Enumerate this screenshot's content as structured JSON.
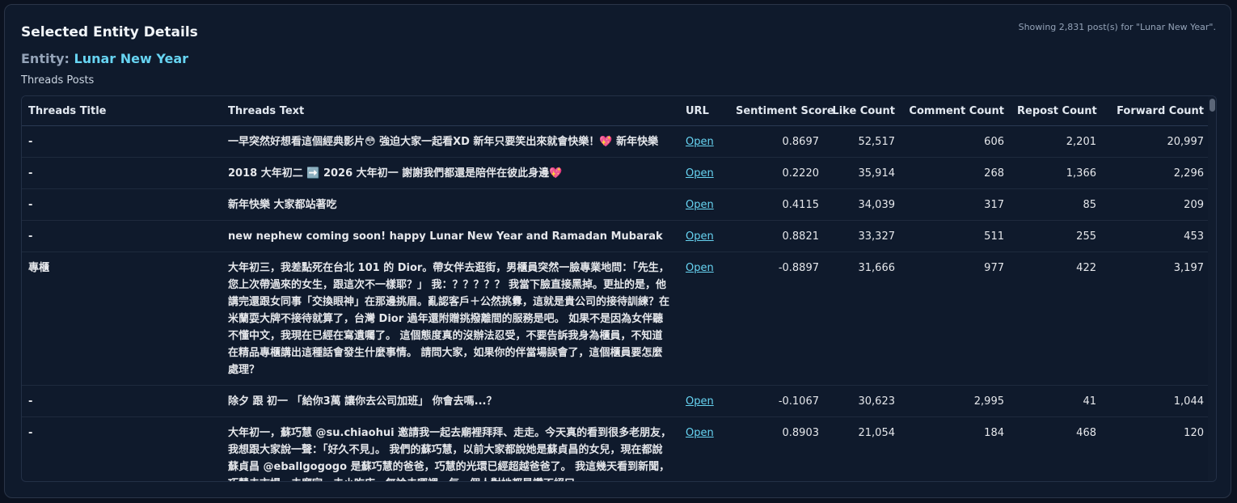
{
  "header": {
    "title": "Selected Entity Details",
    "showing_text": "Showing 2,831 post(s) for \"Lunar New Year\".",
    "entity_prefix": "Entity:",
    "entity_name": "Lunar New Year",
    "section_label": "Threads Posts"
  },
  "table": {
    "columns": {
      "title": "Threads Title",
      "text": "Threads Text",
      "url": "URL",
      "sentiment": "Sentiment Score",
      "likes": "Like Count",
      "comments": "Comment Count",
      "reposts": "Repost Count",
      "forwards": "Forward Count"
    },
    "rows": [
      {
        "title": "-",
        "text": "一早突然好想看這個經典影片😳 強迫大家一起看XD 新年只要笑出來就會快樂！💖 新年快樂",
        "url": "Open",
        "sentiment": "0.8697",
        "likes": "52,517",
        "comments": "606",
        "reposts": "2,201",
        "forwards": "20,997"
      },
      {
        "title": "-",
        "text": "2018 大年初二 ➡️ 2026 大年初一 謝謝我們都還是陪伴在彼此身邊💖",
        "url": "Open",
        "sentiment": "0.2220",
        "likes": "35,914",
        "comments": "268",
        "reposts": "1,366",
        "forwards": "2,296"
      },
      {
        "title": "-",
        "text": "新年快樂 大家都站著吃",
        "url": "Open",
        "sentiment": "0.4115",
        "likes": "34,039",
        "comments": "317",
        "reposts": "85",
        "forwards": "209"
      },
      {
        "title": "-",
        "text": "new nephew coming soon! happy Lunar New Year and Ramadan Mubarak",
        "url": "Open",
        "sentiment": "0.8821",
        "likes": "33,327",
        "comments": "511",
        "reposts": "255",
        "forwards": "453"
      },
      {
        "title": "專櫃",
        "text": "大年初三，我差點死在台北 101 的 Dior。帶女伴去逛街，男櫃員突然一臉專業地問：「先生，您上次帶過來的女生，跟這次不一樣耶？」 我：？？？？？ 我當下臉直接黑掉。更扯的是，他講完還跟女同事「交換眼神」在那邊挑眉。亂認客戶＋公然挑釁，這就是貴公司的接待訓練？在米蘭耍大牌不接待就算了，台灣 Dior 過年還附贈挑撥離間的服務是吧。 如果不是因為女伴聽不懂中文，我現在已經在寫遺囑了。 這個態度真的沒辦法忍受，不要告訴我身為櫃員，不知道在精品專櫃講出這種話會發生什麼事情。 請問大家，如果你的伴當場誤會了，這個櫃員要怎麼處理？",
        "url": "Open",
        "sentiment": "-0.8897",
        "likes": "31,666",
        "comments": "977",
        "reposts": "422",
        "forwards": "3,197"
      },
      {
        "title": "-",
        "text": "除夕 跟 初一 「給你3萬 讓你去公司加班」 你會去嗎...？",
        "url": "Open",
        "sentiment": "-0.1067",
        "likes": "30,623",
        "comments": "2,995",
        "reposts": "41",
        "forwards": "1,044"
      },
      {
        "title": "-",
        "text": "大年初一，蘇巧慧 @su.chiaohui 邀請我一起去廟裡拜拜、走走。今天真的看到很多老朋友，我想跟大家說一聲：「好久不見」。 我們的蘇巧慧，以前大家都說她是蘇貞昌的女兒，現在都說蘇貞昌 @eballgogogo 是蘇巧慧的爸爸，巧慧的光環已經超越爸爸了。 我這幾天看到新聞，巧慧去市場、去廟宇、去小吃店，無論去哪裡，每一個人對她都是讚不絕口。",
        "url": "Open",
        "sentiment": "0.8903",
        "likes": "21,054",
        "comments": "184",
        "reposts": "468",
        "forwards": "120"
      }
    ]
  }
}
